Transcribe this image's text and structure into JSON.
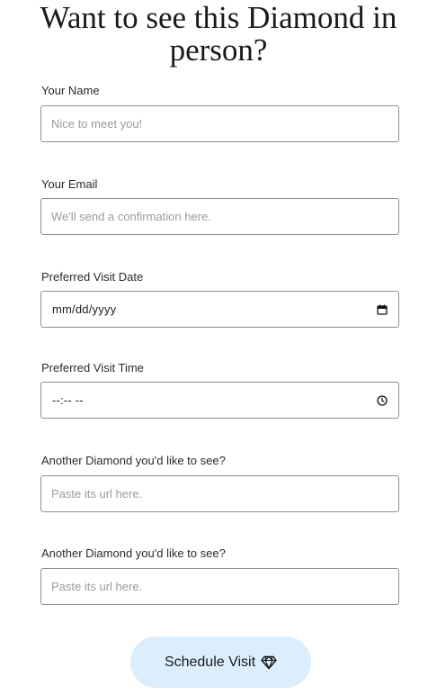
{
  "heading": "Want to see this Diamond in person?",
  "form": {
    "name": {
      "label": "Your Name",
      "placeholder": "Nice to meet you!"
    },
    "email": {
      "label": "Your Email",
      "placeholder": "We'll send a confirmation here."
    },
    "date": {
      "label": "Preferred Visit Date",
      "value_mask": "mm/dd/yyyy",
      "icon": "calendar-icon"
    },
    "time": {
      "label": "Preferred Visit Time",
      "value_mask": "--:-- --",
      "icon": "clock-icon"
    },
    "diamond_1": {
      "label": "Another Diamond you'd like to see?",
      "placeholder": "Paste its url here."
    },
    "diamond_2": {
      "label": "Another Diamond you'd like to see?",
      "placeholder": "Paste its url here."
    }
  },
  "submit": {
    "label": "Schedule Visit",
    "icon": "diamond-icon",
    "background": "#dcedfc"
  },
  "colors": {
    "border": "#8f8f8f",
    "placeholder": "#9a9a9a",
    "text": "#222222"
  }
}
